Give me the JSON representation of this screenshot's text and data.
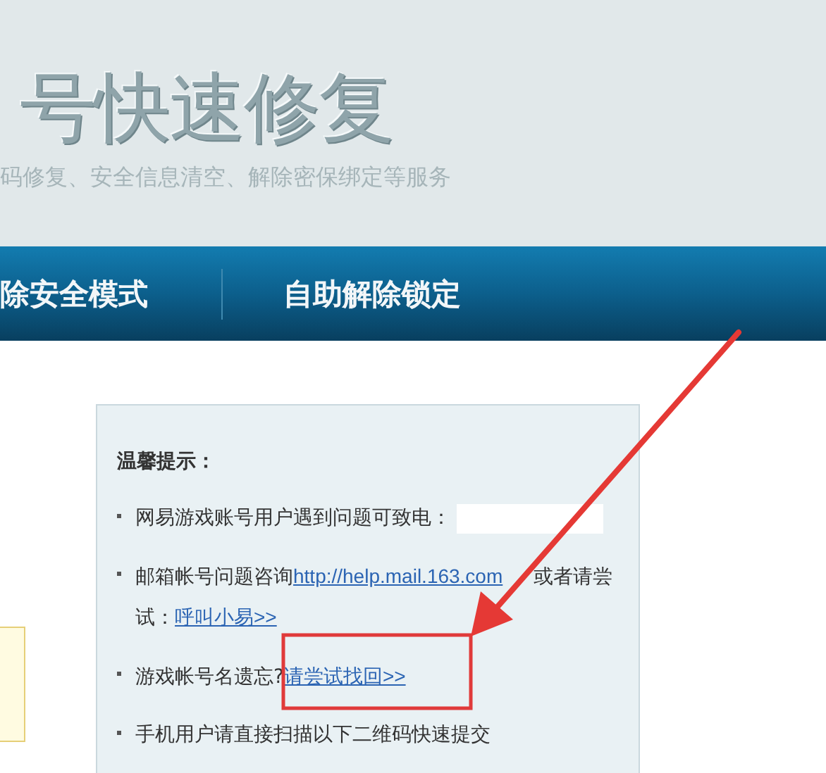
{
  "header": {
    "title": "号快速修复",
    "subtitle": "码修复、安全信息清空、解除密保绑定等服务"
  },
  "nav": [
    {
      "label": "除安全模式"
    },
    {
      "label": "自助解除锁定"
    }
  ],
  "notice": {
    "heading": "温馨提示：",
    "items": [
      {
        "segments": [
          {
            "text": "网易游戏账号用户遇到问题可致电：",
            "link": false
          }
        ],
        "redacted": true
      },
      {
        "segments": [
          {
            "text": "邮箱帐号问题咨询",
            "link": false
          },
          {
            "text": "http://help.mail.163.com",
            "link": true
          },
          {
            "text": "或者请尝试：",
            "link": false
          },
          {
            "text": "呼叫小易>>",
            "link": true
          }
        ],
        "redacted": false
      },
      {
        "segments": [
          {
            "text": "游戏帐号名遗忘?",
            "link": false
          },
          {
            "text": "请尝试找回>>",
            "link": true
          }
        ],
        "redacted": false
      },
      {
        "segments": [
          {
            "text": "手机用户请直接扫描以下二维码快速提交",
            "link": false
          }
        ],
        "redacted": false
      }
    ]
  }
}
